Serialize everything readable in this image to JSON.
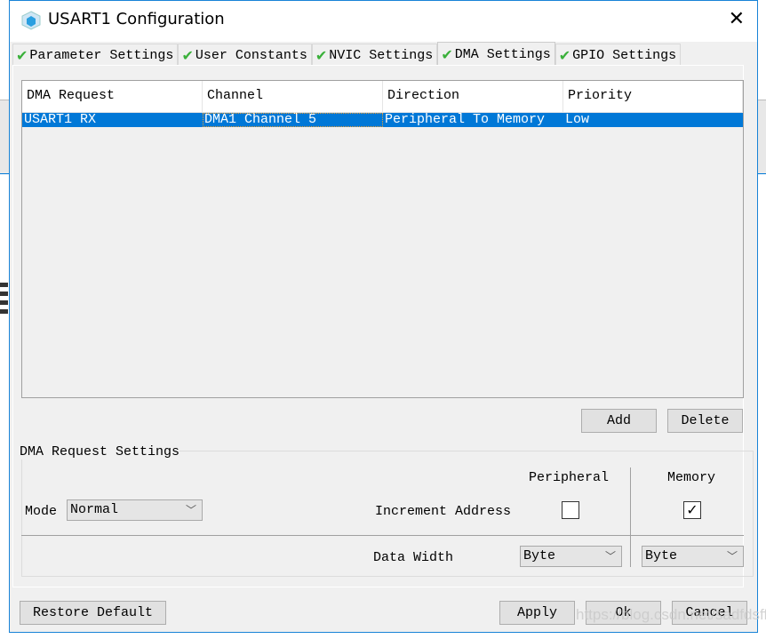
{
  "window": {
    "title": "USART1 Configuration",
    "close_icon": "close-icon",
    "app_icon": "cube-icon"
  },
  "tabs": [
    {
      "label": "Parameter Settings",
      "checked": true
    },
    {
      "label": "User Constants",
      "checked": true
    },
    {
      "label": "NVIC Settings",
      "checked": true
    },
    {
      "label": "DMA Settings",
      "checked": true,
      "active": true
    },
    {
      "label": "GPIO Settings",
      "checked": true
    }
  ],
  "tab_check_glyph": "✔",
  "table": {
    "headers": [
      "DMA Request",
      "Channel",
      "Direction",
      "Priority"
    ],
    "rows": [
      [
        "USART1 RX",
        "DMA1 Channel 5",
        "Peripheral To Memory",
        "Low"
      ]
    ],
    "selected_color": "#0078d7"
  },
  "buttons": {
    "add": "Add",
    "delete": "Delete",
    "restore": "Restore Default",
    "apply": "Apply",
    "ok": "Ok",
    "cancel": "Cancel"
  },
  "settings": {
    "group_title": "DMA Request Settings",
    "mode_label": "Mode",
    "mode_value": "Normal",
    "peripheral_header": "Peripheral",
    "memory_header": "Memory",
    "increment_label": "Increment Address",
    "peripheral_increment": false,
    "memory_increment": true,
    "data_width_label": "Data Width",
    "peripheral_width": "Byte",
    "memory_width": "Byte"
  },
  "watermark": "https://blog.csdn.net/sadfdsfff"
}
